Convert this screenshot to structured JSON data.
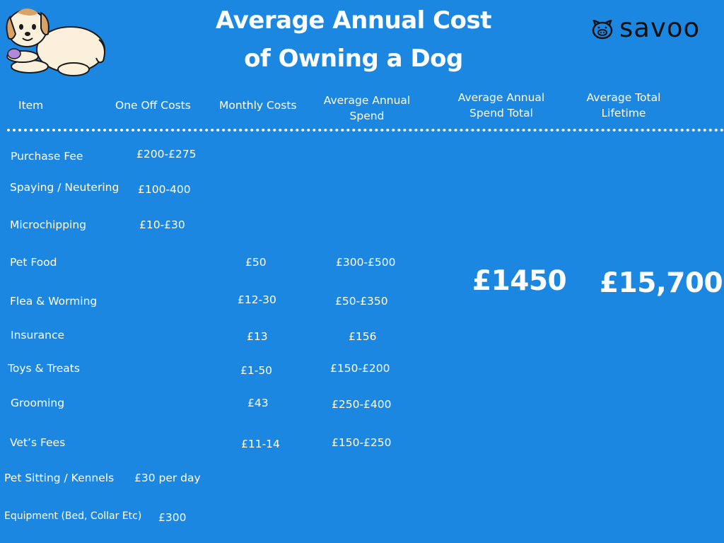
{
  "title_line1": "Average Annual Cost",
  "title_line2": "of Owning a Dog",
  "brand": {
    "name": "savoo",
    "icon": "pig-icon"
  },
  "illustration": "dog-illustration",
  "headers": {
    "item": "Item",
    "one_off": "One Off Costs",
    "monthly": "Monthly Costs",
    "annual_1": "Average Annual",
    "annual_2": "Spend",
    "total_1": "Average Annual",
    "total_2": "Spend Total",
    "lifetime_1": "Average Total",
    "lifetime_2": "Lifetime"
  },
  "rows": [
    {
      "item": "Purchase Fee",
      "one_off": "£200-£275",
      "monthly": "",
      "annual": ""
    },
    {
      "item": "Spaying / Neutering",
      "one_off": "£100-400",
      "monthly": "",
      "annual": ""
    },
    {
      "item": "Microchipping",
      "one_off": "£10-£30",
      "monthly": "",
      "annual": ""
    },
    {
      "item": "Pet Food",
      "one_off": "",
      "monthly": "£50",
      "annual": "£300-£500"
    },
    {
      "item": "Flea & Worming",
      "one_off": "",
      "monthly": "£12-30",
      "annual": "£50-£350"
    },
    {
      "item": "Insurance",
      "one_off": "",
      "monthly": "£13",
      "annual": "£156"
    },
    {
      "item": "Toys & Treats",
      "one_off": "",
      "monthly": "£1-50",
      "annual": "£150-£200"
    },
    {
      "item": "Grooming",
      "one_off": "",
      "monthly": "£43",
      "annual": "£250-£400"
    },
    {
      "item": "Vet’s Fees",
      "one_off": "",
      "monthly": "£11-14",
      "annual": "£150-£250"
    },
    {
      "item": "Pet Sitting / Kennels",
      "one_off": "£30 per day",
      "monthly": "",
      "annual": ""
    },
    {
      "item": "Equipment (Bed, Collar Etc)",
      "one_off": "£300",
      "monthly": "",
      "annual": ""
    }
  ],
  "totals": {
    "annual_total": "£1450",
    "lifetime_total": "£15,700"
  },
  "colors": {
    "background": "#1c87e0",
    "text": "#ffffff",
    "logo": "#111111"
  }
}
